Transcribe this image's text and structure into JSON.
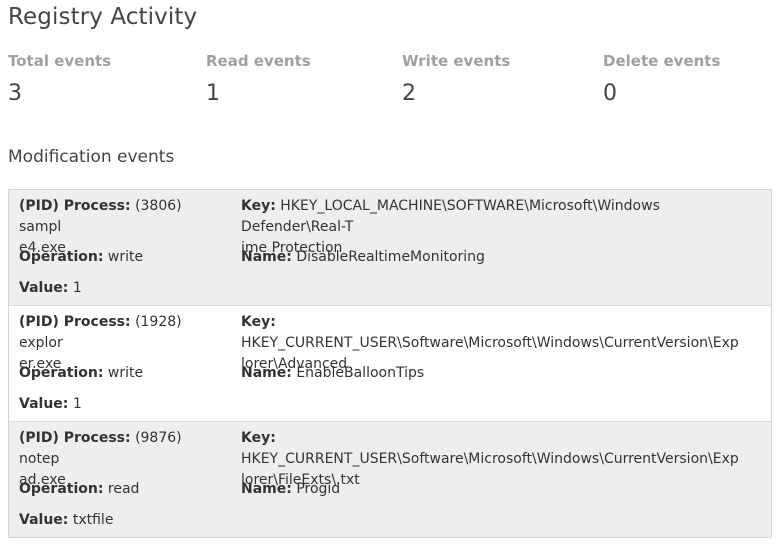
{
  "page_title": "Registry Activity",
  "stats": [
    {
      "label": "Total events",
      "value": "3"
    },
    {
      "label": "Read events",
      "value": "1"
    },
    {
      "label": "Write events",
      "value": "2"
    },
    {
      "label": "Delete events",
      "value": "0"
    }
  ],
  "section_title": "Modification events",
  "field_labels": {
    "process": "(PID) Process:",
    "key": "Key:",
    "operation": "Operation:",
    "name": "Name:",
    "value": "Value:"
  },
  "events": [
    {
      "process_line1": "(3806) sampl",
      "process_line2": "e4.exe",
      "key_line1": "HKEY_LOCAL_MACHINE\\SOFTWARE\\Microsoft\\Windows Defender\\Real-T",
      "key_line2": "ime Protection",
      "operation": "write",
      "name": "DisableRealtimeMonitoring",
      "value": "1"
    },
    {
      "process_line1": "(1928) explor",
      "process_line2": "er.exe",
      "key_line1": "HKEY_CURRENT_USER\\Software\\Microsoft\\Windows\\CurrentVersion\\Exp",
      "key_line2": "lorer\\Advanced",
      "operation": "write",
      "name": "EnableBalloonTips",
      "value": "1"
    },
    {
      "process_line1": "(9876) notep",
      "process_line2": "ad.exe",
      "key_line1": "HKEY_CURRENT_USER\\Software\\Microsoft\\Windows\\CurrentVersion\\Exp",
      "key_line2": "lorer\\FileExts\\.txt",
      "operation": "read",
      "name": "Progid",
      "value": "txtfile"
    }
  ],
  "colors": {
    "row_shaded": "#eeeeee",
    "row_plain": "#ffffff",
    "stat_label": "#a0a0a0",
    "border": "#d4d4d4"
  }
}
